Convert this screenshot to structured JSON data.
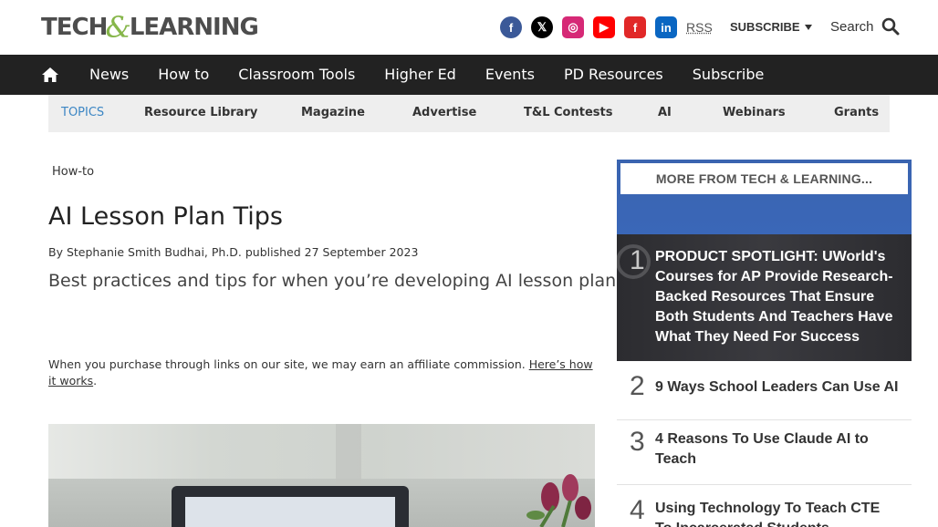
{
  "header": {
    "logo": {
      "part1": "TECH",
      "amp": "&",
      "part2a": "LEARNING"
    },
    "socials": [
      {
        "name": "facebook-icon",
        "glyph": "f",
        "color": "#3b5998"
      },
      {
        "name": "x-icon",
        "glyph": "𝕏",
        "color": "#000000"
      },
      {
        "name": "instagram-icon",
        "glyph": "◎",
        "color": "#d62976"
      },
      {
        "name": "youtube-icon",
        "glyph": "▶",
        "color": "#ff0000"
      },
      {
        "name": "flipboard-icon",
        "glyph": "f",
        "color": "#e12828"
      },
      {
        "name": "linkedin-icon",
        "glyph": "in",
        "color": "#0a66c2"
      }
    ],
    "rss": "RSS",
    "subscribe": "SUBSCRIBE",
    "search": "Search"
  },
  "nav": {
    "items": [
      "News",
      "How to",
      "Classroom Tools",
      "Higher Ed",
      "Events",
      "PD Resources",
      "Subscribe"
    ]
  },
  "topics": {
    "label": "TOPICS",
    "items": [
      "Resource Library",
      "Magazine",
      "Advertise",
      "T&L Contests",
      "AI",
      "Webinars",
      "Grants"
    ]
  },
  "article": {
    "breadcrumb": "How-to",
    "title": "AI Lesson Plan Tips",
    "byline": "By Stephanie Smith Budhai, Ph.D. published 27 September 2023",
    "strap": "Best practices and tips for when you’re developing AI lesson plans",
    "affiliate_text": "When you purchase through links on our site, we may earn an affiliate commission. ",
    "affiliate_link": "Here’s how it works",
    "affiliate_end": "."
  },
  "sidebar": {
    "heading": "MORE FROM TECH & LEARNING...",
    "items": [
      {
        "rank": "1",
        "text": "PRODUCT SPOTLIGHT: UWorld's Courses for AP Provide Research-Backed Resources That Ensure Both Students And Teachers Have What They Need For Success"
      },
      {
        "rank": "2",
        "text": "9 Ways School Leaders Can Use AI"
      },
      {
        "rank": "3",
        "text": "4 Reasons To Use Claude AI to Teach"
      },
      {
        "rank": "4",
        "text": "Using Technology To Teach CTE To Incarcerated Students"
      }
    ]
  }
}
